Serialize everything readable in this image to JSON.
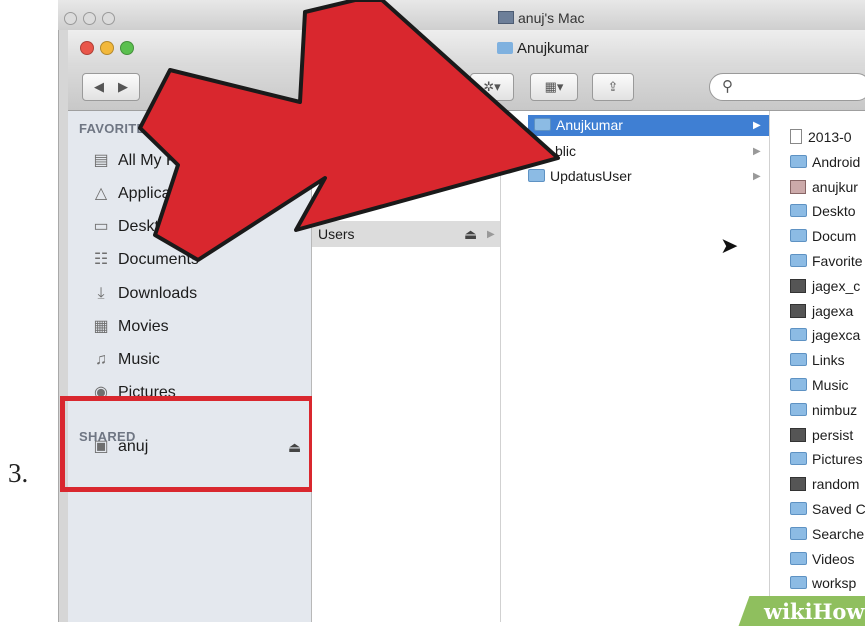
{
  "step_number": "3.",
  "back_window": {
    "title": "anuj's Mac"
  },
  "window": {
    "title": "Anujkumar"
  },
  "toolbar": {
    "back": "◀",
    "forward": "▶",
    "action": "✲▾",
    "view": "▦▾",
    "share": "⇪"
  },
  "sidebar": {
    "favorites_header": "FAVORITES",
    "favorites": [
      {
        "label": "All My Files",
        "icon": "all-files-icon"
      },
      {
        "label": "Applications",
        "icon": "applications-icon"
      },
      {
        "label": "Desktop",
        "icon": "desktop-icon"
      },
      {
        "label": "Documents",
        "icon": "documents-icon"
      },
      {
        "label": "Downloads",
        "icon": "downloads-icon"
      },
      {
        "label": "Movies",
        "icon": "movies-icon"
      },
      {
        "label": "Music",
        "icon": "music-icon"
      },
      {
        "label": "Pictures",
        "icon": "pictures-icon"
      }
    ],
    "shared_header": "SHARED",
    "shared": [
      {
        "label": "anuj",
        "icon": "computer-icon"
      }
    ]
  },
  "column2": [
    {
      "label": "Users"
    }
  ],
  "column3": [
    {
      "label": "Anujkumar",
      "selected": true
    },
    {
      "label": "blic"
    },
    {
      "label": "UpdatusUser"
    }
  ],
  "column4": [
    {
      "label": "2013-0",
      "kind": "doc"
    },
    {
      "label": "Android",
      "kind": "folder"
    },
    {
      "label": "anujkur",
      "kind": "image"
    },
    {
      "label": "Deskto",
      "kind": "folder"
    },
    {
      "label": "Docum",
      "kind": "folder"
    },
    {
      "label": "Favorite",
      "kind": "folder"
    },
    {
      "label": "jagex_c",
      "kind": "file"
    },
    {
      "label": "jagexa",
      "kind": "file"
    },
    {
      "label": "jagexca",
      "kind": "folder"
    },
    {
      "label": "Links",
      "kind": "folder"
    },
    {
      "label": "Music",
      "kind": "folder"
    },
    {
      "label": "nimbuz",
      "kind": "folder"
    },
    {
      "label": "persist",
      "kind": "file"
    },
    {
      "label": "Pictures",
      "kind": "folder"
    },
    {
      "label": "random",
      "kind": "file"
    },
    {
      "label": "Saved C",
      "kind": "folder"
    },
    {
      "label": "Searche",
      "kind": "folder"
    },
    {
      "label": "Videos",
      "kind": "folder"
    },
    {
      "label": "worksp",
      "kind": "folder"
    }
  ],
  "watermark": "wikiHow",
  "colors": {
    "arrow": "#d9272e",
    "highlight": "#d9272e",
    "selection": "#3f7fd3"
  }
}
